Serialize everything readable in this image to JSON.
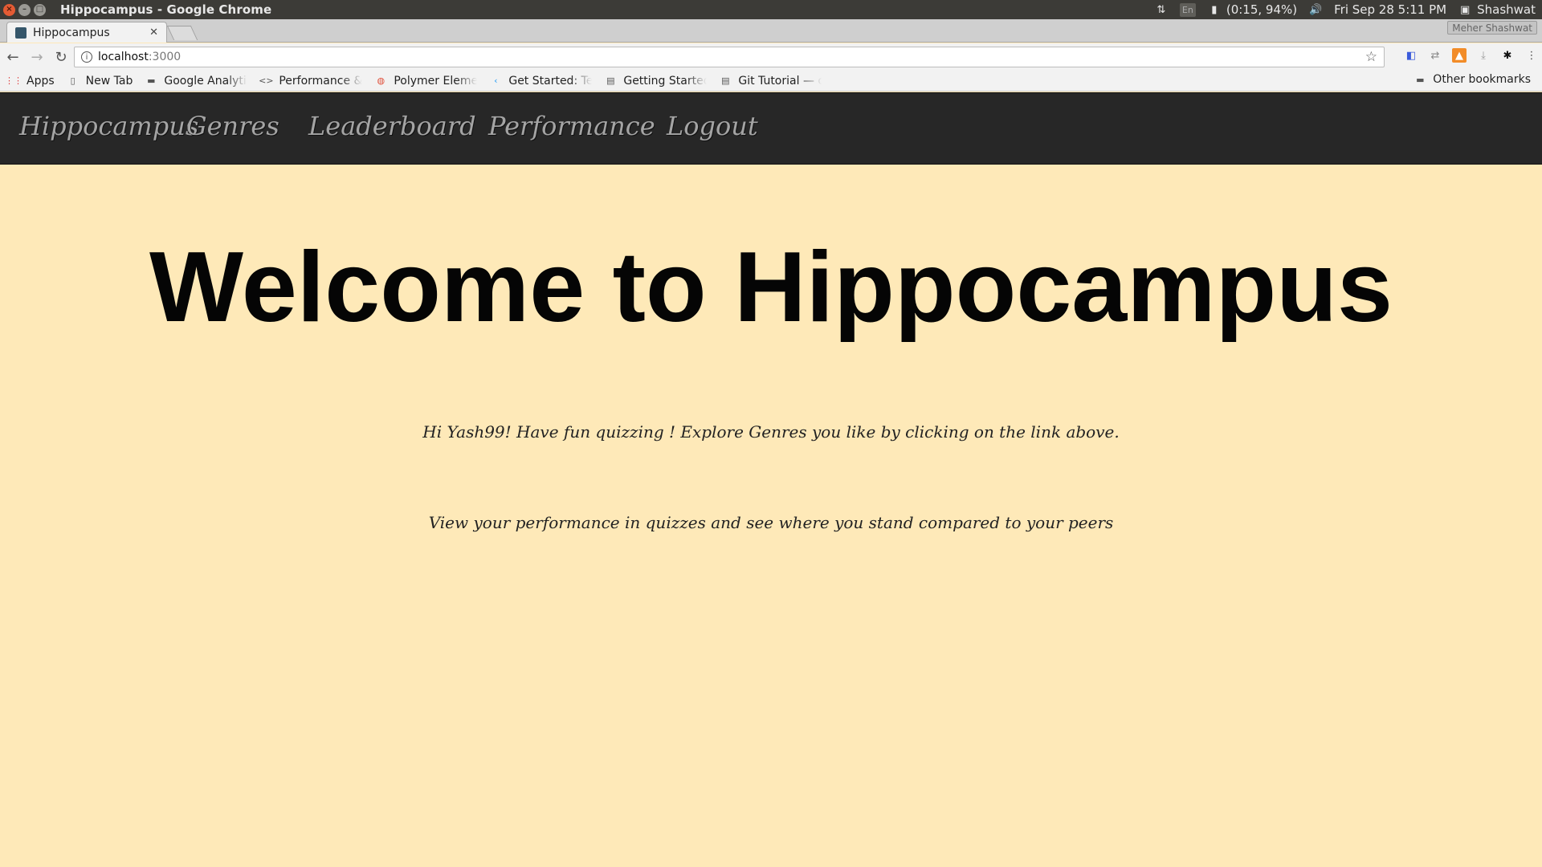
{
  "os": {
    "window_title": "Hippocampus - Google Chrome",
    "lang": "En",
    "battery": "(0:15, 94%)",
    "datetime": "Fri Sep 28  5:11 PM",
    "user": "Shashwat"
  },
  "browser": {
    "tab_title": "Hippocampus",
    "profile": "Meher Shashwat",
    "url_host": "localhost",
    "url_port": ":3000",
    "bookmarks": [
      {
        "label": "Apps",
        "icon": "apps-grid-icon"
      },
      {
        "label": "New Tab",
        "icon": "page-icon"
      },
      {
        "label": "Google Analytic",
        "icon": "folder-icon"
      },
      {
        "label": "Performance & ",
        "icon": "code-icon"
      },
      {
        "label": "Polymer Elemen",
        "icon": "polymer-icon"
      },
      {
        "label": "Get Started: Tes",
        "icon": "flutter-icon"
      },
      {
        "label": "Getting Started",
        "icon": "doc-icon"
      },
      {
        "label": "Git Tutorial — c",
        "icon": "doc-icon"
      }
    ],
    "other_bookmarks": "Other bookmarks"
  },
  "navbar": {
    "brand": "Hippocampus",
    "links": [
      "Genres",
      "Leaderboard",
      "Performance",
      "Logout"
    ]
  },
  "main": {
    "heading": "Welcome to Hippocampus",
    "line1": "Hi Yash99! Have fun quizzing ! Explore Genres you like by clicking on the link above.",
    "line2": "View your performance in quizzes and see where you stand compared to your peers"
  }
}
